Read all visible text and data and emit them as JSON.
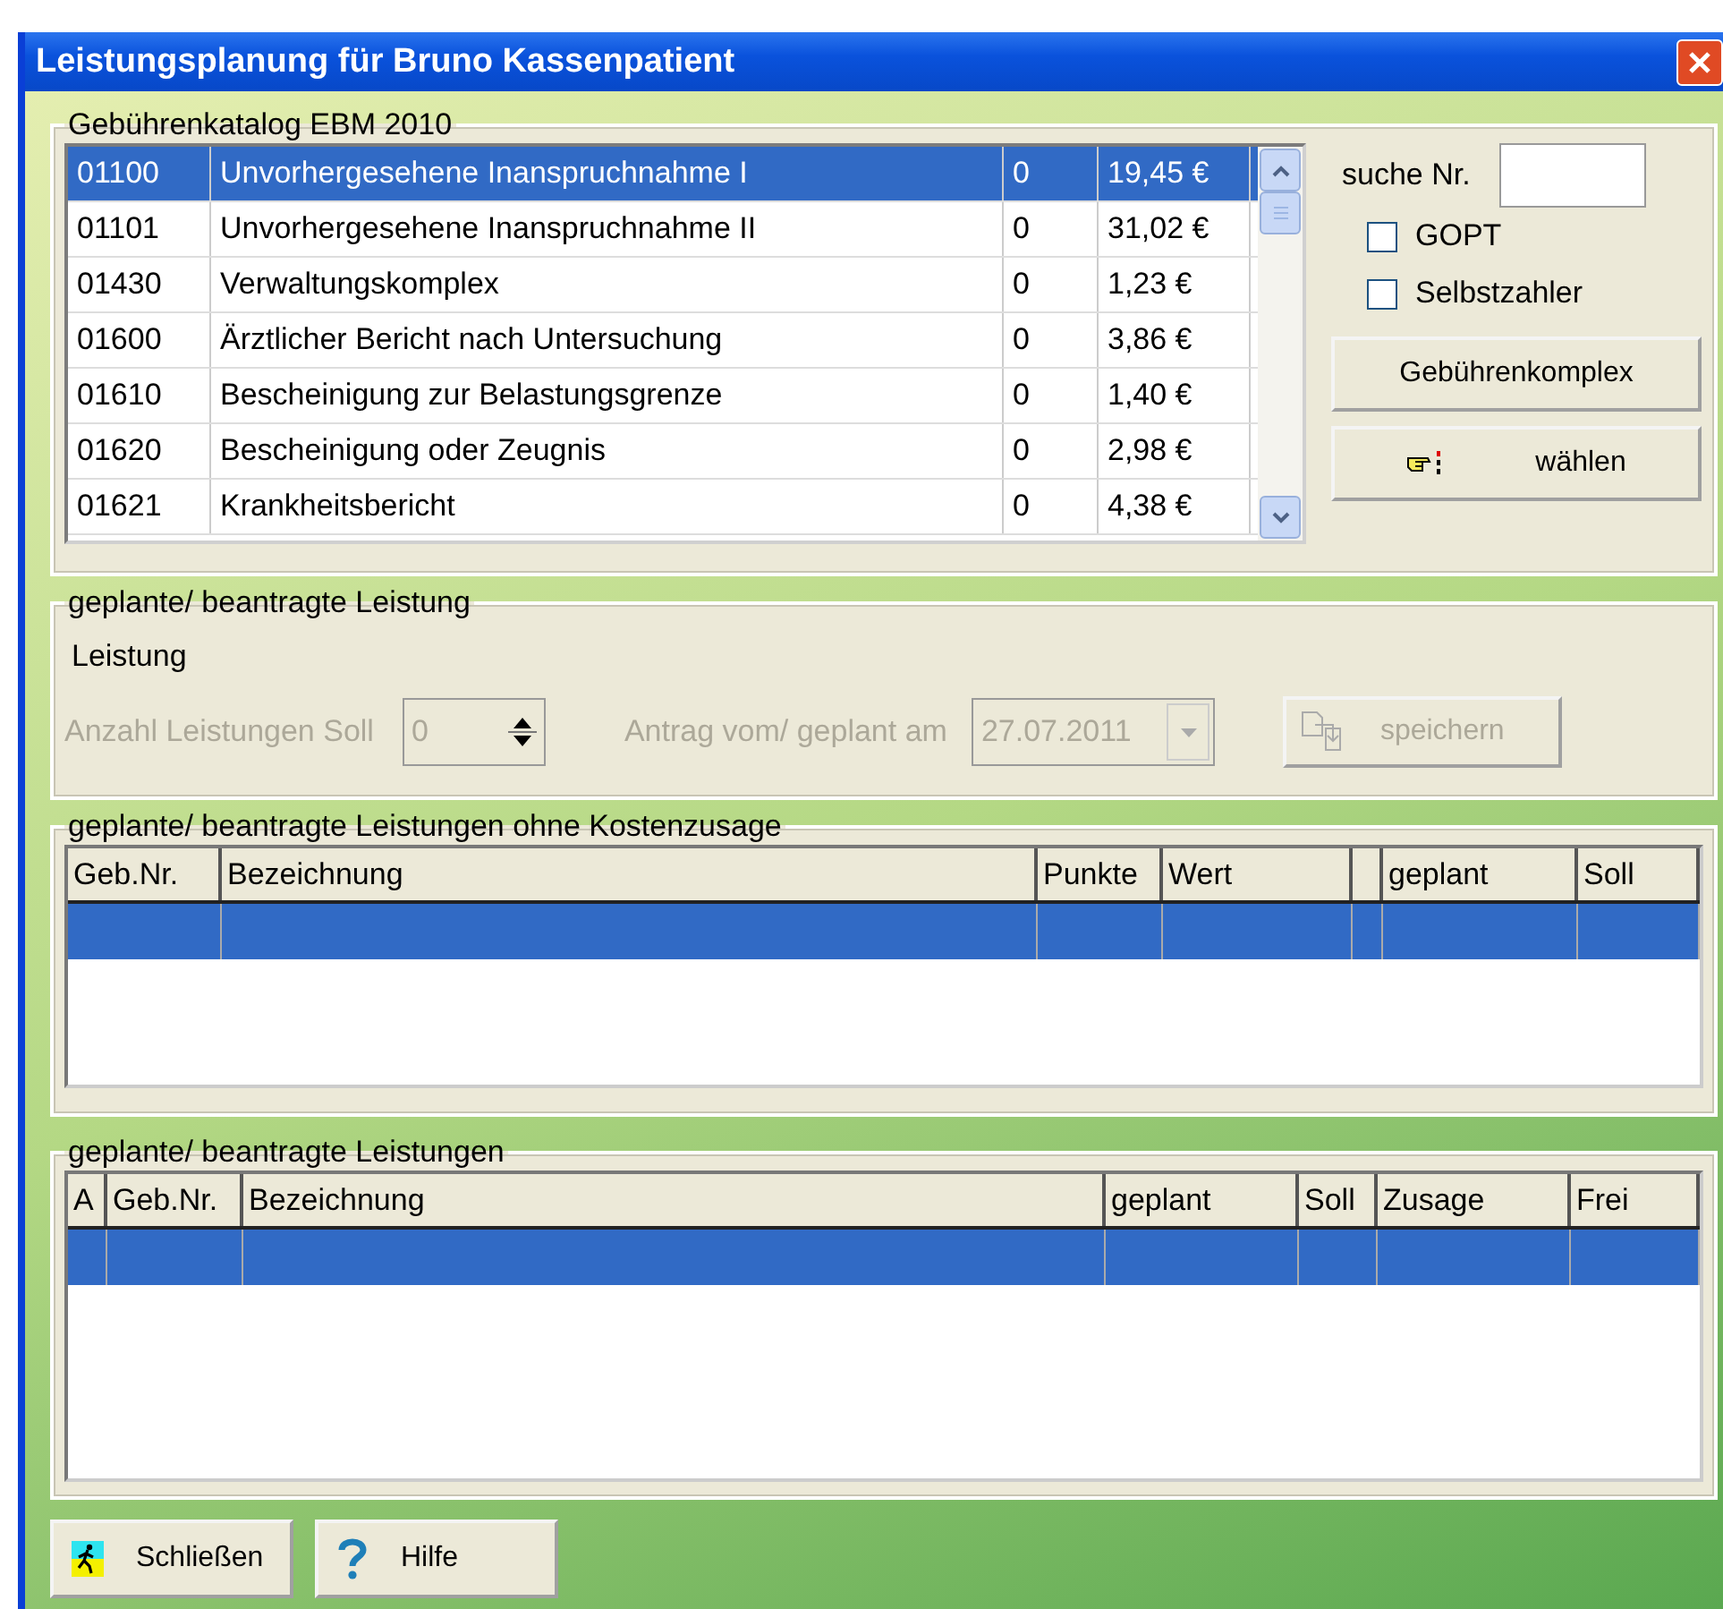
{
  "window": {
    "title": "Leistungsplanung für Bruno Kassenpatient"
  },
  "catalog": {
    "legend": "Gebührenkatalog EBM 2010",
    "rows": [
      {
        "code": "01100",
        "name": "Unvorhergesehene Inanspruchnahme I",
        "points": "0",
        "value": "19,45 €",
        "selected": true
      },
      {
        "code": "01101",
        "name": "Unvorhergesehene Inanspruchnahme II",
        "points": "0",
        "value": "31,02 €",
        "selected": false
      },
      {
        "code": "01430",
        "name": "Verwaltungskomplex",
        "points": "0",
        "value": "1,23 €",
        "selected": false
      },
      {
        "code": "01600",
        "name": "Ärztlicher Bericht nach Untersuchung",
        "points": "0",
        "value": "3,86 €",
        "selected": false
      },
      {
        "code": "01610",
        "name": "Bescheinigung zur Belastungsgrenze",
        "points": "0",
        "value": "1,40 €",
        "selected": false
      },
      {
        "code": "01620",
        "name": "Bescheinigung oder Zeugnis",
        "points": "0",
        "value": "2,98 €",
        "selected": false
      },
      {
        "code": "01621",
        "name": "Krankheitsbericht",
        "points": "0",
        "value": "4,38 €",
        "selected": false
      }
    ],
    "search_label": "suche Nr.",
    "checkboxes": [
      {
        "label": "GOPT",
        "checked": false
      },
      {
        "label": "Selbstzahler",
        "checked": false
      }
    ],
    "buttons": [
      {
        "label": "Gebührenkomplex",
        "kind": "plain"
      },
      {
        "label": "wählen",
        "kind": "hand"
      }
    ]
  },
  "planning": {
    "legend": "geplante/ beantragte Leistung",
    "leistung": "Leistung",
    "count": {
      "label": "Anzahl Leistungen Soll",
      "value": "0",
      "disabled": true
    },
    "date": {
      "label": "Antrag vom/ geplant am",
      "value": "27.07.2011",
      "disabled": true
    },
    "save_button": {
      "label": "speichern",
      "disabled": true
    }
  },
  "table_uncommitted": {
    "legend": "geplante/ beantragte Leistungen ohne Kostenzusage",
    "columns": [
      {
        "label": "Geb.Nr."
      },
      {
        "label": "Bezeichnung"
      },
      {
        "label": "Punkte"
      },
      {
        "label": "Wert"
      },
      {},
      {
        "label": "geplant"
      },
      {
        "label": "Soll"
      }
    ],
    "rows": [
      {
        "selected": true
      }
    ]
  },
  "table_planned": {
    "legend": "geplante/ beantragte Leistungen",
    "columns": [
      {
        "label": "A"
      },
      {
        "label": "Geb.Nr."
      },
      {
        "label": "Bezeichnung"
      },
      {
        "label": "geplant"
      },
      {
        "label": "Soll"
      },
      {
        "label": "Zusage"
      },
      {
        "label": "Frei"
      }
    ],
    "rows": [
      {
        "selected": true
      }
    ]
  },
  "footer_buttons": [
    {
      "label": "Schließen",
      "kind": "close"
    },
    {
      "label": "Hilfe",
      "kind": "help"
    }
  ]
}
